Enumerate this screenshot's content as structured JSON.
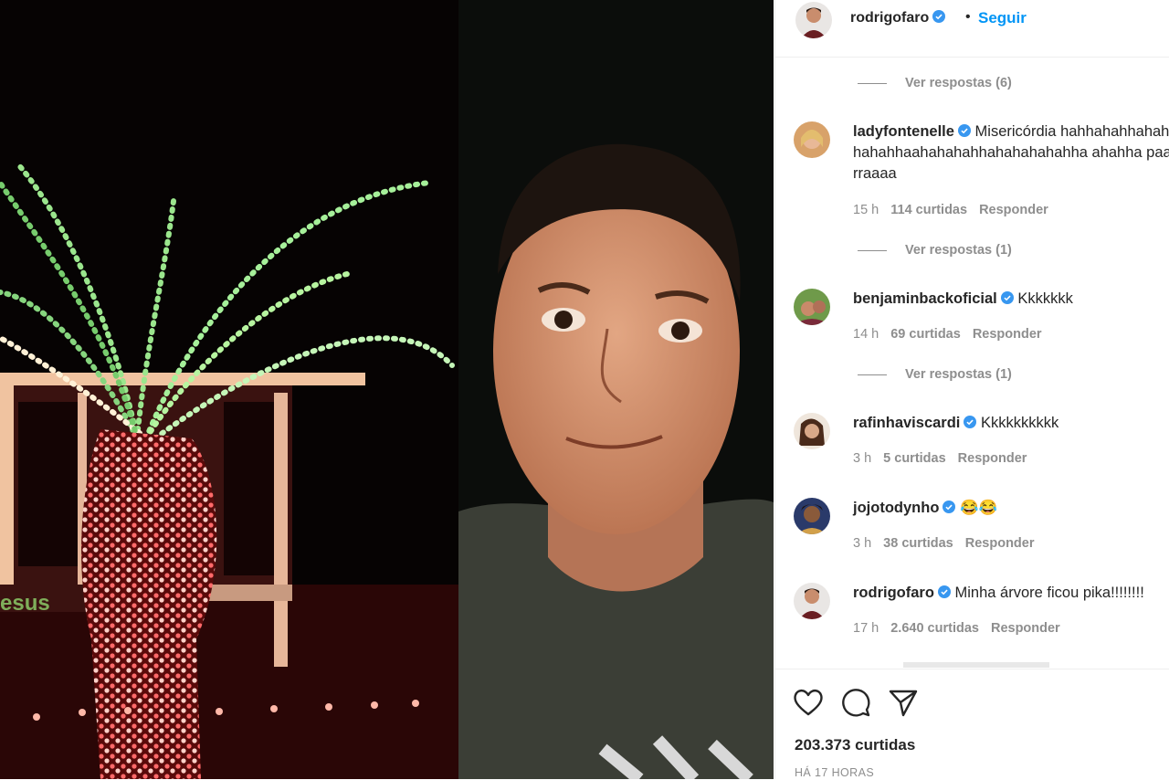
{
  "header": {
    "username": "rodrigofaro",
    "separator": "•",
    "follow_label": "Seguir"
  },
  "comments": [
    {
      "type": "replies",
      "label": "Ver respostas (6)"
    },
    {
      "type": "comment",
      "username": "ladyfontenelle",
      "text": "Misericórdia hahhahahhahahahahahhaahahahahhahahahahahha ahahha paaarraaaa",
      "time": "15 h",
      "likes": "114 curtidas",
      "reply": "Responder"
    },
    {
      "type": "replies",
      "label": "Ver respostas (1)"
    },
    {
      "type": "comment",
      "username": "benjaminbackoficial",
      "text": "Kkkkkkk",
      "time": "14 h",
      "likes": "69 curtidas",
      "reply": "Responder"
    },
    {
      "type": "replies",
      "label": "Ver respostas (1)"
    },
    {
      "type": "comment",
      "username": "rafinhaviscardi",
      "text": "Kkkkkkkkkk",
      "time": "3 h",
      "likes": "5 curtidas",
      "reply": "Responder"
    },
    {
      "type": "comment",
      "username": "jojotodynho",
      "text": "😂😂",
      "time": "3 h",
      "likes": "38 curtidas",
      "reply": "Responder"
    },
    {
      "type": "comment",
      "username": "rodrigofaro",
      "text": "Minha árvore ficou pika!!!!!!!!",
      "time": "17 h",
      "likes": "2.640 curtidas",
      "reply": "Responder"
    }
  ],
  "actions": {
    "icons": [
      "heart-icon",
      "comment-icon",
      "share-icon"
    ],
    "likes": "203.373 curtidas",
    "timestamp": "HÁ 17 HORAS"
  },
  "colors": {
    "link_blue": "#0095f6",
    "muted": "#8e8e8e",
    "verified": "#3897f0"
  }
}
